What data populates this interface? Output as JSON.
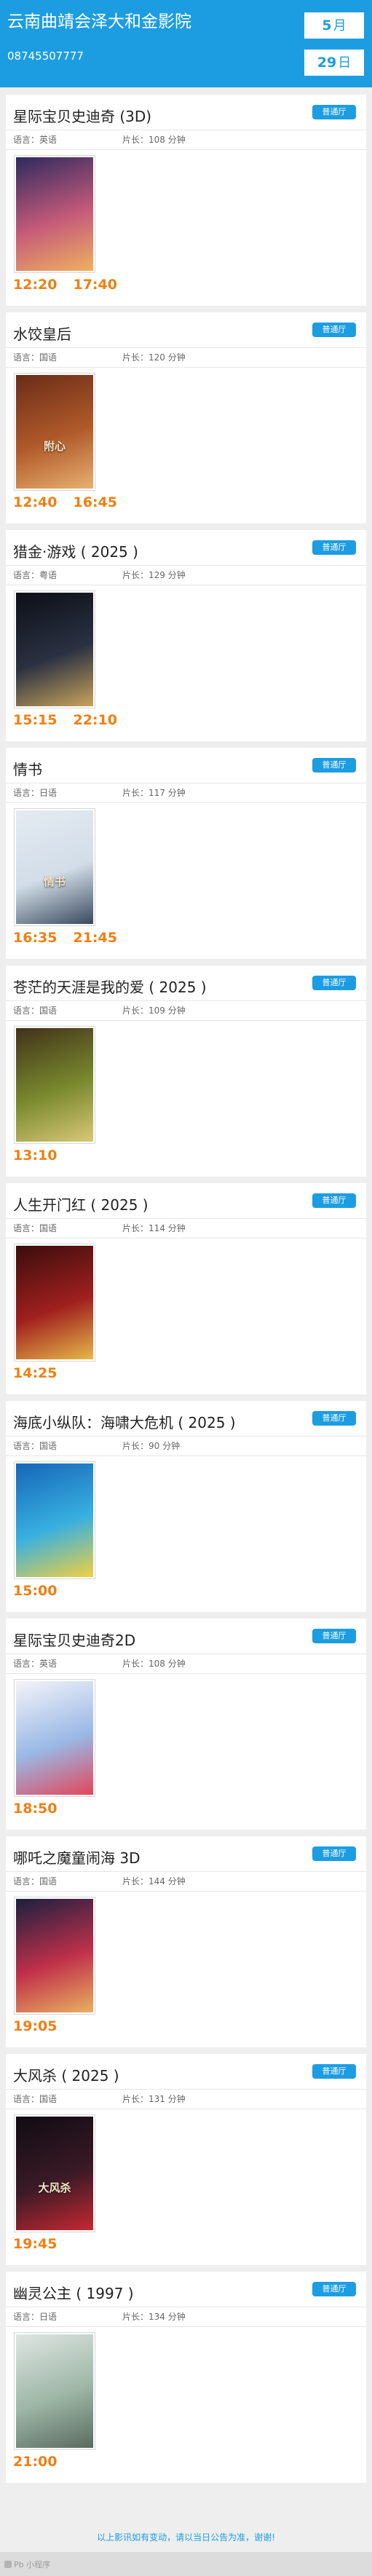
{
  "header": {
    "cinema_name": "云南曲靖会泽大和金影院",
    "phone": "08745507777",
    "month_value": "5",
    "month_unit": "月",
    "day_value": "29",
    "day_unit": "日"
  },
  "movies": [
    {
      "title": "星际宝贝史迪奇 (3D)",
      "hall": "普通厅",
      "language": "语言：英语",
      "length": "片长：108 分钟",
      "times": [
        "12:20",
        "17:40"
      ],
      "poster_text": "",
      "poster_colors": [
        "#2e2a5e",
        "#c45a7a",
        "#f0b060"
      ]
    },
    {
      "title": "水饺皇后",
      "hall": "普通厅",
      "language": "语言：国语",
      "length": "片长：120 分钟",
      "times": [
        "12:40",
        "16:45"
      ],
      "poster_text": "附心",
      "poster_colors": [
        "#6a2c18",
        "#b05a2a",
        "#e8b070"
      ]
    },
    {
      "title": "猎金·游戏 ( 2025 )",
      "hall": "普通厅",
      "language": "语言：粤语",
      "length": "片长：129 分钟",
      "times": [
        "15:15",
        "22:10"
      ],
      "poster_text": "",
      "poster_colors": [
        "#0c0f16",
        "#2a3142",
        "#c8a45a"
      ]
    },
    {
      "title": "情书",
      "hall": "普通厅",
      "language": "语言：日语",
      "length": "片长：117 分钟",
      "times": [
        "16:35",
        "21:45"
      ],
      "poster_text": "情书",
      "poster_colors": [
        "#e4ebf2",
        "#d2dde8",
        "#3a4a5c"
      ]
    },
    {
      "title": "苍茫的天涯是我的爱 ( 2025 )",
      "hall": "普通厅",
      "language": "语言：国语",
      "length": "片长：109 分钟",
      "times": [
        "13:10"
      ],
      "poster_text": "",
      "poster_colors": [
        "#41321a",
        "#7a8a2e",
        "#d8c878"
      ]
    },
    {
      "title": "人生开门红 ( 2025 )",
      "hall": "普通厅",
      "language": "语言：国语",
      "length": "片长：114 分钟",
      "times": [
        "14:25"
      ],
      "poster_text": "",
      "poster_colors": [
        "#3a0d0d",
        "#a0201e",
        "#e6b84a"
      ]
    },
    {
      "title": "海底小纵队：海啸大危机 ( 2025 )",
      "hall": "普通厅",
      "language": "语言：国语",
      "length": "片长：90 分钟",
      "times": [
        "15:00"
      ],
      "poster_text": "",
      "poster_colors": [
        "#1666b8",
        "#38b0e0",
        "#f0d040"
      ]
    },
    {
      "title": "星际宝贝史迪奇2D",
      "hall": "普通厅",
      "language": "语言：英语",
      "length": "片长：108 分钟",
      "times": [
        "18:50"
      ],
      "poster_text": "",
      "poster_colors": [
        "#f4f4f8",
        "#9ab8e6",
        "#e2475a"
      ]
    },
    {
      "title": "哪吒之魔童闹海 3D",
      "hall": "普通厅",
      "language": "语言：国语",
      "length": "片长：144 分钟",
      "times": [
        "19:05"
      ],
      "poster_text": "",
      "poster_colors": [
        "#1a1f40",
        "#c0304a",
        "#eab060"
      ]
    },
    {
      "title": "大风杀 ( 2025 )",
      "hall": "普通厅",
      "language": "语言：国语",
      "length": "片长：131 分钟",
      "times": [
        "19:45"
      ],
      "poster_text": "大风杀",
      "poster_colors": [
        "#100c12",
        "#3a1a26",
        "#c62832"
      ]
    },
    {
      "title": "幽灵公主 ( 1997 )",
      "hall": "普通厅",
      "language": "语言：日语",
      "length": "片长：134 分钟",
      "times": [
        "21:00"
      ],
      "poster_text": "",
      "poster_colors": [
        "#dfe6e2",
        "#9db6a6",
        "#5a6b60"
      ]
    }
  ],
  "footer": {
    "notice": "以上影讯如有变动，请以当日公告为准，谢谢!",
    "brand": "Pb 小程序"
  }
}
